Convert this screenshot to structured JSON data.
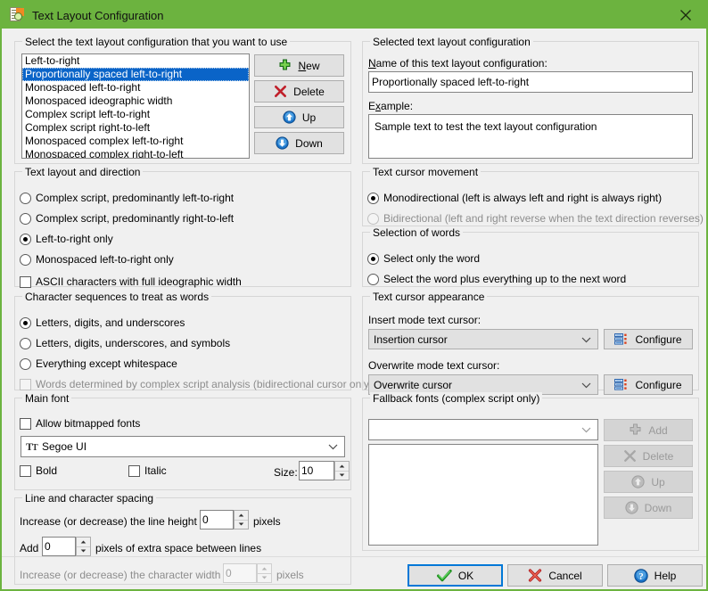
{
  "window": {
    "title": "Text Layout Configuration",
    "title_icon": "document-magnifier-icon",
    "close_icon": "close-icon",
    "accent_color": "#6cb33f"
  },
  "left": {
    "select_group": {
      "legend": "Select the text layout configuration that you want to use",
      "items": [
        "Left-to-right",
        "Proportionally spaced left-to-right",
        "Monospaced left-to-right",
        "Monospaced ideographic width",
        "Complex script left-to-right",
        "Complex script right-to-left",
        "Monospaced complex left-to-right",
        "Monospaced complex right-to-left"
      ],
      "selected_index": 1,
      "buttons": [
        {
          "label": "New",
          "icon": "plus-icon",
          "accel": "N"
        },
        {
          "label": "Delete",
          "icon": "cross-icon"
        },
        {
          "label": "Up",
          "icon": "arrow-up-circle-icon"
        },
        {
          "label": "Down",
          "icon": "arrow-down-circle-icon"
        }
      ]
    },
    "direction_group": {
      "legend": "Text layout and direction",
      "options": [
        {
          "label": "Complex script, predominantly left-to-right",
          "selected": false
        },
        {
          "label": "Complex script, predominantly right-to-left",
          "selected": false
        },
        {
          "label": "Left-to-right only",
          "selected": true
        },
        {
          "label": "Monospaced left-to-right only",
          "selected": false
        }
      ],
      "checkbox": {
        "label": "ASCII characters with full ideographic width",
        "checked": false
      }
    },
    "words_group": {
      "legend": "Character sequences to treat as words",
      "options": [
        {
          "label": "Letters, digits, and underscores",
          "selected": true
        },
        {
          "label": "Letters, digits, underscores, and symbols",
          "selected": false
        },
        {
          "label": "Everything except whitespace",
          "selected": false
        }
      ],
      "checkbox": {
        "label": "Words determined by complex script analysis (bidirectional cursor only)",
        "checked": false,
        "disabled": true
      }
    },
    "font_group": {
      "legend": "Main font",
      "allow_bitmapped": {
        "label": "Allow bitmapped fonts",
        "checked": false
      },
      "font_value": "Segoe UI",
      "font_icon": "truetype-icon",
      "bold": {
        "label": "Bold",
        "checked": false
      },
      "italic": {
        "label": "Italic",
        "checked": false
      },
      "size_label": "Size:",
      "size_value": "10"
    },
    "spacing_group": {
      "legend": "Line and character spacing",
      "line_height_prefix": "Increase (or decrease) the line height by",
      "line_height_value": "0",
      "line_height_suffix": "pixels",
      "add_prefix": "Add",
      "add_value": "0",
      "add_suffix": "pixels of extra space between lines",
      "char_width_prefix": "Increase (or decrease) the character width by",
      "char_width_value": "0",
      "char_width_suffix": "pixels"
    }
  },
  "right": {
    "selected_group": {
      "legend": "Selected text layout configuration",
      "name_label_pre": "N",
      "name_label_post": "ame of this text layout configuration:",
      "name_value": "Proportionally spaced left-to-right",
      "example_label_pre": "E",
      "example_label_mid": "x",
      "example_label_post": "ample:",
      "example_value": "Sample text to test the text layout configuration"
    },
    "cursor_movement_group": {
      "legend": "Text cursor movement",
      "options": [
        {
          "label": "Monodirectional (left is always left and right is always right)",
          "selected": true,
          "disabled": false
        },
        {
          "label": "Bidirectional (left and right reverse when the text direction reverses)",
          "selected": false,
          "disabled": true
        }
      ]
    },
    "selection_group": {
      "legend": "Selection of words",
      "options": [
        {
          "label": "Select only the word",
          "selected": true
        },
        {
          "label": "Select the word plus everything up to the next word",
          "selected": false
        }
      ]
    },
    "cursor_appearance_group": {
      "legend": "Text cursor appearance",
      "insert_label": "Insert mode text cursor:",
      "insert_value": "Insertion cursor",
      "insert_button": "Configure",
      "overwrite_label": "Overwrite mode text cursor:",
      "overwrite_value": "Overwrite cursor",
      "overwrite_button": "Configure",
      "button_icon": "settings-list-icon"
    },
    "fallback_group": {
      "legend": "Fallback fonts (complex script only)",
      "combo_value": "",
      "list_items": [],
      "buttons": [
        {
          "label": "Add",
          "icon": "plus-icon",
          "disabled": true
        },
        {
          "label": "Delete",
          "icon": "cross-icon",
          "disabled": true
        },
        {
          "label": "Up",
          "icon": "arrow-up-circle-icon",
          "disabled": true
        },
        {
          "label": "Down",
          "icon": "arrow-down-circle-icon",
          "disabled": true
        }
      ]
    }
  },
  "footer": {
    "ok": {
      "label": "OK",
      "icon": "check-icon",
      "default": true
    },
    "cancel": {
      "label": "Cancel",
      "icon": "cross-icon"
    },
    "help": {
      "label": "Help",
      "icon": "question-circle-icon"
    }
  }
}
